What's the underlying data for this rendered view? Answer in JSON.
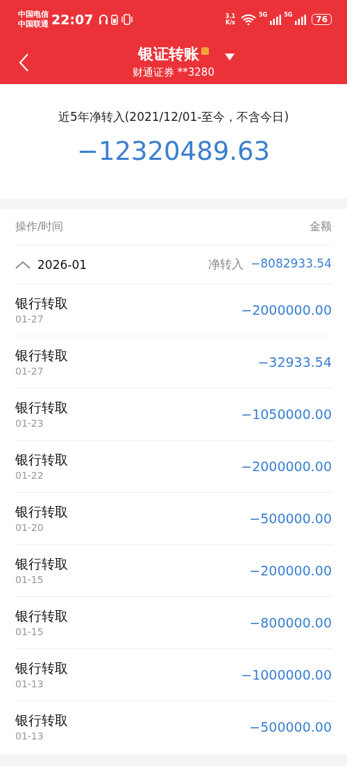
{
  "status_bar": {
    "carriers": [
      "中国电信",
      "中国联通"
    ],
    "time": "22:07",
    "speed": [
      "3.1",
      "K/s"
    ],
    "network": [
      "5G",
      "5G"
    ],
    "battery": "76"
  },
  "header": {
    "title": "银证转账",
    "account": "财通证券 **3280"
  },
  "summary": {
    "label": "近5年净转入(2021/12/01-至今，不含今日)",
    "amount": "−12320489.63"
  },
  "columns": [
    "操作/时间",
    "金额"
  ],
  "groups": [
    {
      "month": "2026-01",
      "expanded": true,
      "net_label": "净转入",
      "net_amount": "−8082933.54",
      "rows": [
        {
          "operation": "银行转取",
          "date": "01-27",
          "amount": "−2000000.00"
        },
        {
          "operation": "银行转取",
          "date": "01-27",
          "amount": "−32933.54"
        },
        {
          "operation": "银行转取",
          "date": "01-23",
          "amount": "−1050000.00"
        },
        {
          "operation": "银行转取",
          "date": "01-22",
          "amount": "−2000000.00"
        },
        {
          "operation": "银行转取",
          "date": "01-20",
          "amount": "−500000.00"
        },
        {
          "operation": "银行转取",
          "date": "01-15",
          "amount": "−200000.00"
        },
        {
          "operation": "银行转取",
          "date": "01-15",
          "amount": "−800000.00"
        },
        {
          "operation": "银行转取",
          "date": "01-13",
          "amount": "−1000000.00"
        },
        {
          "operation": "银行转取",
          "date": "01-13",
          "amount": "−500000.00"
        }
      ]
    }
  ]
}
